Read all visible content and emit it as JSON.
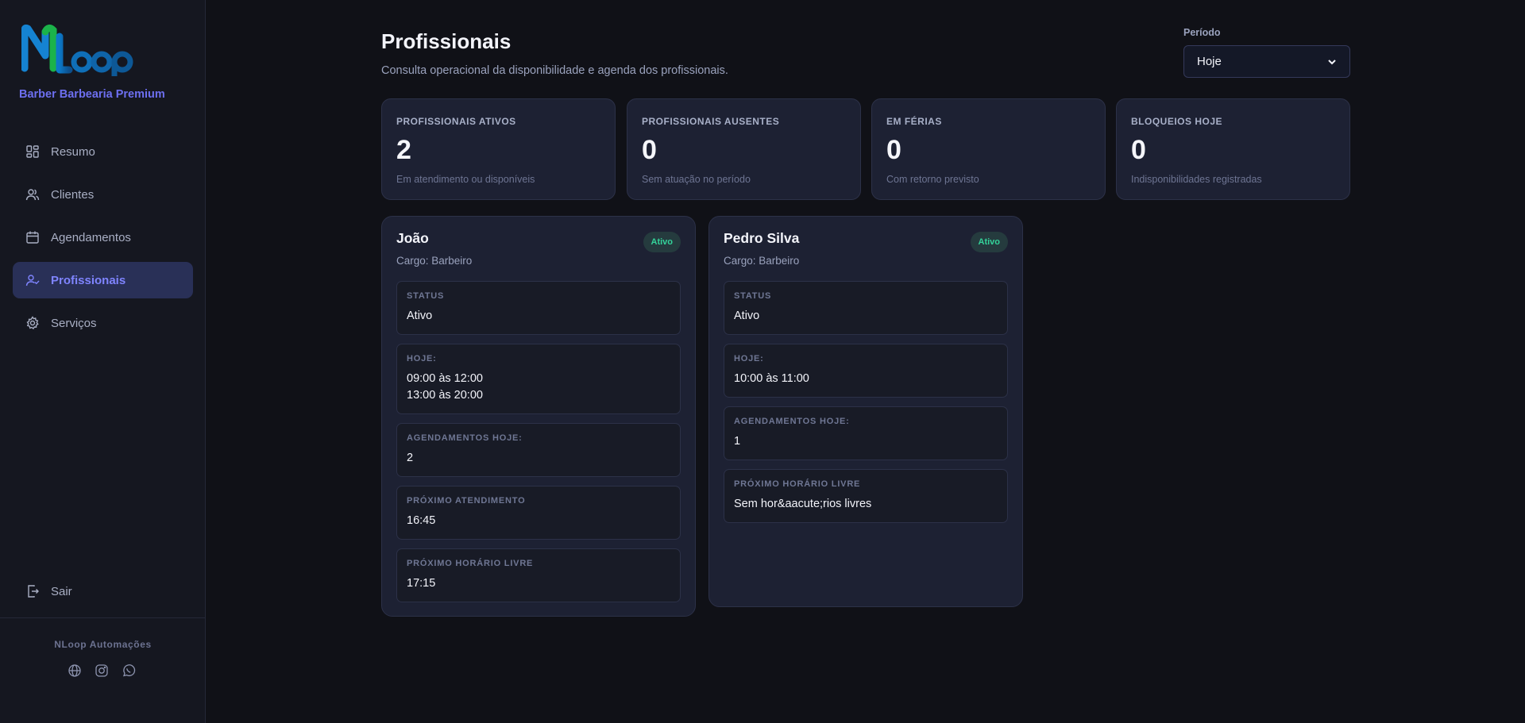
{
  "sidebar": {
    "logo_text": "NLoop",
    "tenant": "Barber Barbearia Premium",
    "items": [
      {
        "label": "Resumo",
        "icon": "dashboard-icon"
      },
      {
        "label": "Clientes",
        "icon": "users-icon"
      },
      {
        "label": "Agendamentos",
        "icon": "calendar-icon"
      },
      {
        "label": "Profissionais",
        "icon": "user-check-icon",
        "active": true
      },
      {
        "label": "Serviços",
        "icon": "gear-icon"
      }
    ],
    "logout": "Sair",
    "footer_brand": "NLoop Automações",
    "social": [
      "globe-icon",
      "instagram-icon",
      "whatsapp-icon"
    ]
  },
  "header": {
    "title": "Profissionais",
    "subtitle": "Consulta operacional da disponibilidade e agenda dos profissionais.",
    "period_label": "Período",
    "period_value": "Hoje"
  },
  "stats": [
    {
      "label": "Profissionais ativos",
      "value": "2",
      "hint": "Em atendimento ou disponíveis"
    },
    {
      "label": "Profissionais ausentes",
      "value": "0",
      "hint": "Sem atuação no período"
    },
    {
      "label": "Em férias",
      "value": "0",
      "hint": "Com retorno previsto"
    },
    {
      "label": "Bloqueios hoje",
      "value": "0",
      "hint": "Indisponibilidades registradas"
    }
  ],
  "professionals": [
    {
      "name": "João",
      "role": "Cargo: Barbeiro",
      "badge": "Ativo",
      "boxes": [
        {
          "label": "Status",
          "value": "Ativo"
        },
        {
          "label": "Hoje:",
          "value": "09:00 às 12:00\n13:00 às 20:00"
        },
        {
          "label": "Agendamentos hoje:",
          "value": "2"
        },
        {
          "label": "Próximo atendimento",
          "value": "16:45"
        },
        {
          "label": "Próximo horário livre",
          "value": "17:15"
        }
      ]
    },
    {
      "name": "Pedro Silva",
      "role": "Cargo: Barbeiro",
      "badge": "Ativo",
      "boxes": [
        {
          "label": "Status",
          "value": "Ativo"
        },
        {
          "label": "Hoje:",
          "value": "10:00 às 11:00"
        },
        {
          "label": "Agendamentos hoje:",
          "value": "1"
        },
        {
          "label": "Próximo horário livre",
          "value": "Sem hor&aacute;rios livres"
        }
      ]
    }
  ],
  "colors": {
    "background": "#101117",
    "sidebar": "#151720",
    "card": "#1d2133",
    "accent": "#7f84ff",
    "badge_text": "#34d39a"
  }
}
